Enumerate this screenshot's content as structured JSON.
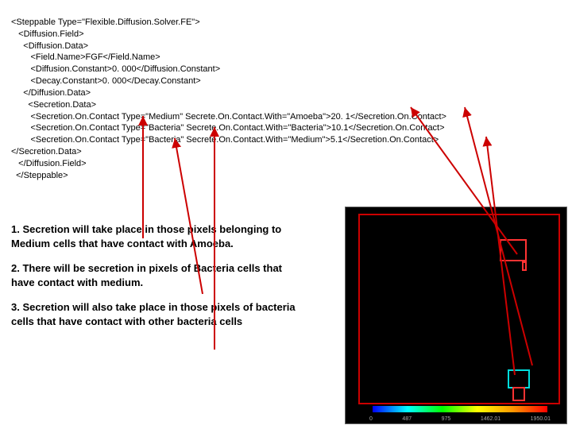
{
  "code": {
    "l1": "<Steppable Type=\"Flexible.Diffusion.Solver.FE\">",
    "l2": "   <Diffusion.Field>",
    "l3": "     <Diffusion.Data>",
    "l4": "        <Field.Name>FGF</Field.Name>",
    "l5": "        <Diffusion.Constant>0. 000</Diffusion.Constant>",
    "l6": "        <Decay.Constant>0. 000</Decay.Constant>",
    "l7": "     </Diffusion.Data>",
    "l8": "       <Secretion.Data>",
    "l9": "        <Secretion.On.Contact Type=\"Medium\" Secrete.On.Contact.With=\"Amoeba\">20. 1</Secretion.On.Contact>",
    "l10": "        <Secretion.On.Contact Type=\"Bacteria\" Secrete.On.Contact.With=\"Bacteria\">10.1</Secretion.On.Contact>",
    "l11": "        <Secretion.On.Contact Type=\"Bacteria\" Secrete.On.Contact.With=\"Medium\">5.1</Secretion.On.Contact>",
    "l12": "</Secretion.Data>",
    "l13": "   </Diffusion.Field>",
    "l14": "  </Steppable>"
  },
  "exp": {
    "p1": "1. Secretion will take place in those pixels belonging to Medium cells that have contact with Amoeba.",
    "p2": "2. There will be secretion in pixels of Bacteria cells that have contact with medium.",
    "p3": "3. Secretion will also take place in those pixels of bacteria cells that have contact with other bacteria cells"
  },
  "ticks": {
    "t1": "0",
    "t2": "487",
    "t3": "975",
    "t4": "1462.01",
    "t5": "1950.01"
  }
}
